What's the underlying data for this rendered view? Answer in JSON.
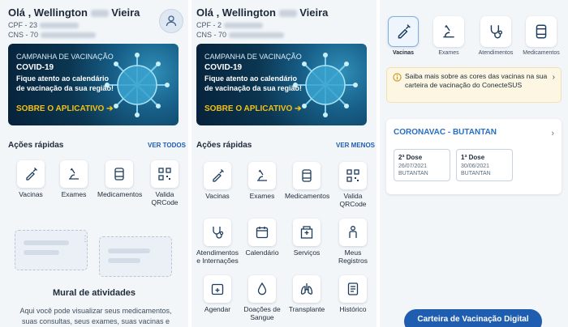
{
  "screen1": {
    "greeting_prefix": "Olá , Wellington",
    "greeting_suffix": "Vieira",
    "cpf": "CPF - 23",
    "cns": "CNS - 70",
    "banner": {
      "small": "CAMPANHA DE VACINAÇÃO",
      "title": "COVID-19",
      "text": "Fique atento ao calendário de vacinação da sua região!",
      "link": "SOBRE O APLICATIVO"
    },
    "section_title": "Ações rápidas",
    "section_link": "VER TODOS",
    "quick_actions": [
      {
        "label": "Vacinas",
        "icon": "syringe-icon"
      },
      {
        "label": "Exames",
        "icon": "microscope-icon"
      },
      {
        "label": "Medicamentos",
        "icon": "pills-icon"
      },
      {
        "label": "Valida QRCode",
        "icon": "qrcode-icon"
      }
    ],
    "mural_title": "Mural de atividades",
    "mural_text": "Aqui você pode visualizar seus medicamentos, suas consultas, seus exames, suas vacinas e mais..."
  },
  "screen2": {
    "greeting_prefix": "Olá , Wellington",
    "greeting_suffix": "Vieira",
    "cpf": "CPF - 2",
    "cns": "CNS - 70",
    "banner": {
      "small": "CAMPANHA DE VACINAÇÃO",
      "title": "COVID-19",
      "text": "Fique atento ao calendário de vacinação da sua região!",
      "link": "SOBRE O APLICATIVO"
    },
    "section_title": "Ações rápidas",
    "section_link": "VER MENOS",
    "quick_actions": [
      {
        "label": "Vacinas",
        "icon": "syringe-icon"
      },
      {
        "label": "Exames",
        "icon": "microscope-icon"
      },
      {
        "label": "Medicamentos",
        "icon": "pills-icon"
      },
      {
        "label": "Valida QRCode",
        "icon": "qrcode-icon"
      },
      {
        "label": "Atendimentos e Internações",
        "icon": "stethoscope-icon"
      },
      {
        "label": "Calendário",
        "icon": "calendar-icon"
      },
      {
        "label": "Serviços",
        "icon": "hospital-icon"
      },
      {
        "label": "Meus Registros",
        "icon": "person-icon"
      },
      {
        "label": "Agendar",
        "icon": "calendar-plus-icon"
      },
      {
        "label": "Doações de Sangue",
        "icon": "blood-drop-icon"
      },
      {
        "label": "Transplante",
        "icon": "lungs-icon"
      },
      {
        "label": "Histórico",
        "icon": "history-icon"
      }
    ]
  },
  "screen3": {
    "tabs": [
      {
        "label": "Vacinas",
        "icon": "syringe-icon",
        "active": true
      },
      {
        "label": "Exames",
        "icon": "microscope-icon",
        "active": false
      },
      {
        "label": "Atendimentos",
        "icon": "stethoscope-icon",
        "active": false
      },
      {
        "label": "Medicamentos",
        "icon": "pills-icon",
        "active": false
      }
    ],
    "info_text": "Saiba mais sobre as cores das vacinas na sua carteira de vacinação do ConecteSUS",
    "vaccine": {
      "title": "CORONAVAC - BUTANTAN",
      "doses": [
        {
          "dose": "2ª Dose",
          "date": "26/07/2021",
          "maker": "BUTANTAN"
        },
        {
          "dose": "1ª Dose",
          "date": "30/06/2021",
          "maker": "BUTANTAN"
        }
      ]
    },
    "cta": "Carteira de Vacinação Digital"
  },
  "colors": {
    "primary": "#1f5db0",
    "accent_link": "#f2c114",
    "vaccine_title": "#2a6fc0",
    "info_bg": "#fdf6e3"
  }
}
